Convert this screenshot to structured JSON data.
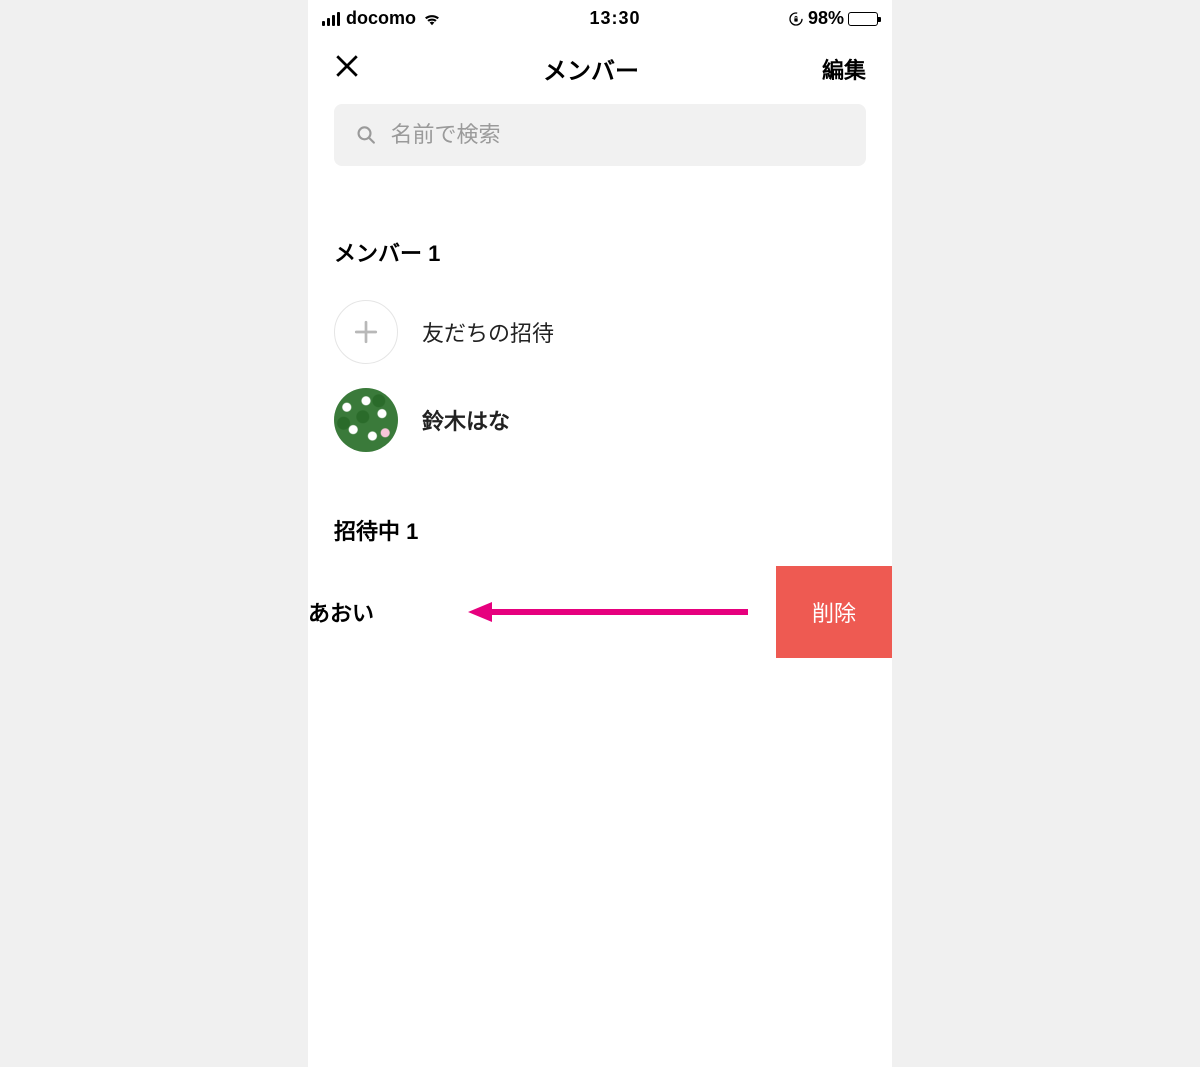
{
  "status_bar": {
    "carrier": "docomo",
    "time": "13:30",
    "battery_text": "98%"
  },
  "header": {
    "title": "メンバー",
    "edit": "編集"
  },
  "search": {
    "placeholder": "名前で検索"
  },
  "members_section": {
    "title": "メンバー 1",
    "invite_label": "友だちの招待",
    "member_name": "鈴木はな"
  },
  "pending_section": {
    "title": "招待中 1",
    "pending_name": "あおい",
    "delete_label": "削除"
  }
}
